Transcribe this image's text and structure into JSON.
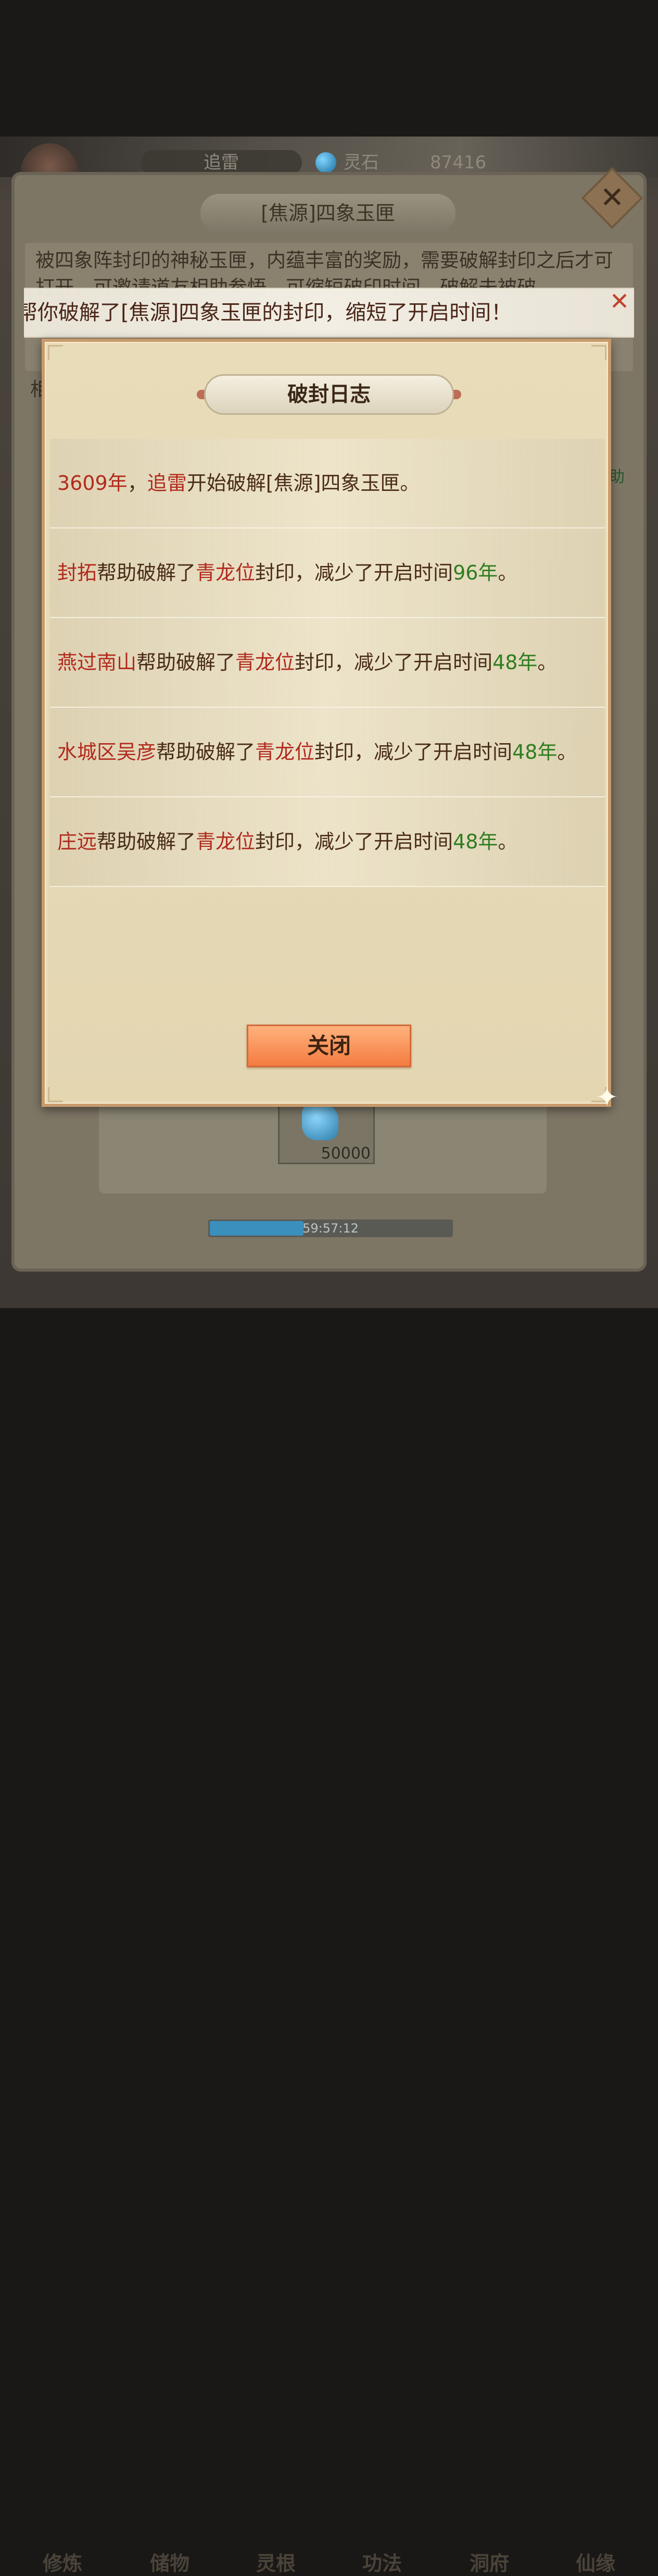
{
  "hud": {
    "player_name": "追雷",
    "currency_label": "灵石",
    "currency_value": "87416"
  },
  "background_panel": {
    "title": "[焦源]四象玉匣",
    "description": "被四象阵封印的神秘玉匣，内蕴丰富的奖励，需要破解封印之后才可打开，可邀请道友相助参悟，可缩短破印时间。破解未被破",
    "side_text_left": "相",
    "side_text_right": "助",
    "item_count": "50000",
    "timer": "59:57:12"
  },
  "bottom_nav": {
    "items": [
      "修炼",
      "储物",
      "灵根",
      "功法",
      "洞府",
      "仙缘"
    ]
  },
  "toast": {
    "text": "帮你破解了[焦源]四象玉匣的封印，缩短了开启时间！"
  },
  "modal": {
    "title": "破封日志",
    "entries": [
      {
        "year": "3609年",
        "sep": "，",
        "name": "追雷",
        "action": "开始破解[焦源]四象玉匣。"
      },
      {
        "name": "封拓",
        "mid": "帮助破解了",
        "pos": "青龙位",
        "tail": "封印，减少了开启时间",
        "amount": "96年",
        "end": "。"
      },
      {
        "name": "燕过南山",
        "mid": "帮助破解了",
        "pos": "青龙位",
        "tail": "封印，减少了开启时间",
        "amount": "48年",
        "end": "。"
      },
      {
        "name": "水城区吴彦",
        "mid": "帮助破解了",
        "pos": "青龙位",
        "tail": "封印，减少了开启时间",
        "amount": "48年",
        "end": "。"
      },
      {
        "name": "庄远",
        "mid": "帮助破解了",
        "pos": "青龙位",
        "tail": "封印，减少了开启时间",
        "amount": "48年",
        "end": "。"
      }
    ],
    "close_label": "关闭"
  },
  "colors": {
    "highlight_red": "#b22a1d",
    "highlight_green": "#2f7d1f",
    "button_orange": "#f47c40"
  }
}
